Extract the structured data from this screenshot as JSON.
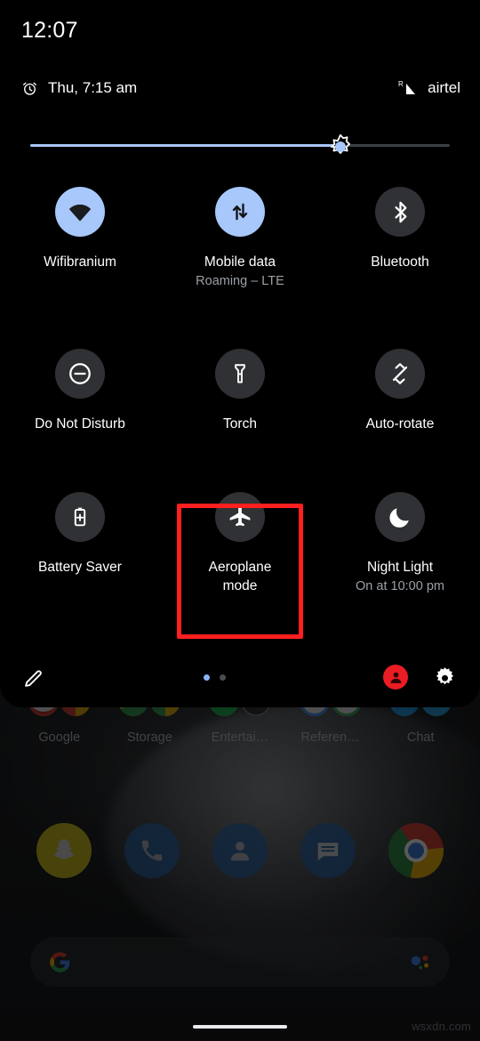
{
  "status_bar": {
    "clock": "12:07",
    "alarm_icon": "alarm-clock-icon",
    "alarm_text": "Thu, 7:15 am",
    "roaming_indicator": "R",
    "signal_icon": "signal-bars-icon",
    "carrier": "airtel"
  },
  "brightness": {
    "name": "brightness-slider",
    "icon": "brightness-sun-icon",
    "value_percent": 74
  },
  "tiles": [
    {
      "id": "wifi",
      "label": "Wifibranium",
      "sub": "",
      "icon": "wifi-icon",
      "active": true
    },
    {
      "id": "mobile-data",
      "label": "Mobile data",
      "sub": "Roaming – LTE",
      "icon": "mobile-data-arrows-icon",
      "active": true
    },
    {
      "id": "bluetooth",
      "label": "Bluetooth",
      "sub": "",
      "icon": "bluetooth-icon",
      "active": false
    },
    {
      "id": "do-not-disturb",
      "label": "Do Not Disturb",
      "sub": "",
      "icon": "do-not-disturb-icon",
      "active": false
    },
    {
      "id": "torch",
      "label": "Torch",
      "sub": "",
      "icon": "flashlight-icon",
      "active": false
    },
    {
      "id": "auto-rotate",
      "label": "Auto-rotate",
      "sub": "",
      "icon": "auto-rotate-icon",
      "active": false
    },
    {
      "id": "battery-saver",
      "label": "Battery Saver",
      "sub": "",
      "icon": "battery-saver-icon",
      "active": false
    },
    {
      "id": "aeroplane-mode",
      "label": "Aeroplane mode",
      "sub": "",
      "icon": "airplane-icon",
      "active": false,
      "highlighted": true
    },
    {
      "id": "night-light",
      "label": "Night Light",
      "sub": "On at 10:00 pm",
      "icon": "moon-crescent-icon",
      "active": false
    }
  ],
  "highlight": {
    "color": "#ff1f1f",
    "target": "aeroplane-mode"
  },
  "footer": {
    "edit_icon": "pencil-edit-icon",
    "pages": 2,
    "active_page": 1,
    "user_icon": "user-avatar-icon",
    "user_color": "#ea1c24",
    "settings_icon": "gear-settings-icon"
  },
  "home_screen": {
    "folders": [
      {
        "label": "Google"
      },
      {
        "label": "Storage"
      },
      {
        "label": "Entertai…"
      },
      {
        "label": "Referen…"
      },
      {
        "label": "Chat"
      }
    ],
    "dock": [
      {
        "name": "snapchat-icon",
        "color": "#d8d11a"
      },
      {
        "name": "phone-icon",
        "color": "#2a5d96"
      },
      {
        "name": "contacts-icon",
        "color": "#2a5d96"
      },
      {
        "name": "messages-icon",
        "color": "#2a5d96"
      },
      {
        "name": "chrome-icon",
        "color": "#3b7ddd"
      }
    ],
    "search": {
      "name": "google-search-bar",
      "google_icon": "google-g-icon",
      "assistant_icon": "google-assistant-icon",
      "placeholder": ""
    }
  },
  "watermark": "wsxdn.com",
  "colors": {
    "tile_active_bg": "#a8c7fa",
    "tile_inactive_bg": "#303134",
    "accent_blue": "#8ab4f8",
    "highlight_red": "#ff1f1f",
    "panel_bg": "#000000",
    "label_white": "#ffffff",
    "label_gray": "#9aa0a6"
  }
}
